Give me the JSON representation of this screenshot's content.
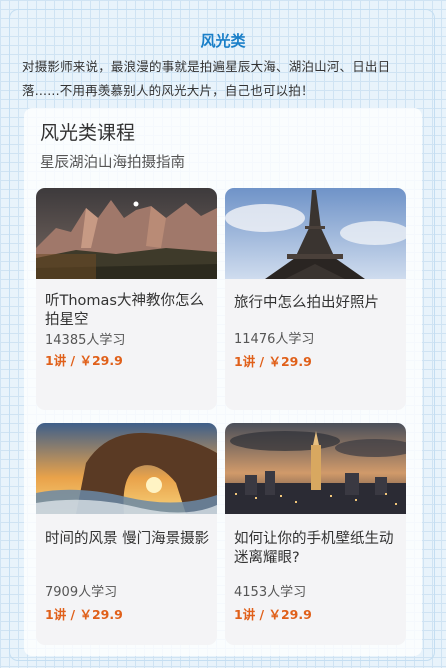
{
  "section": {
    "title": "风光类",
    "intro": "对摄影师来说，最浪漫的事就是拍遍星辰大海、湖泊山河、日出日落......不用再羡慕别人的风光大片，自己也可以拍！"
  },
  "courses": {
    "heading": "风光类课程",
    "subheading": "星辰湖泊山海拍摄指南",
    "cards": [
      {
        "title": "听Thomas大神教你怎么拍星空",
        "learners": "14385人学习",
        "price": "1讲 / ￥29.9",
        "image": "mountain-night-photo"
      },
      {
        "title": "旅行中怎么拍出好照片",
        "learners": "11476人学习",
        "price": "1讲 / ￥29.9",
        "image": "eiffel-tower-photo"
      },
      {
        "title": "时间的风景 慢门海景摄影",
        "learners": "7909人学习",
        "price": "1讲 / ￥29.9",
        "image": "sea-arch-sunset-photo"
      },
      {
        "title": "如何让你的手机壁纸生动迷离耀眼?",
        "learners": "4153人学习",
        "price": "1讲 / ￥29.9",
        "image": "city-skyline-dusk-photo"
      }
    ]
  },
  "colors": {
    "accent_title": "#1a7fc8",
    "price": "#e0601a",
    "background": "#e8f3fb"
  }
}
